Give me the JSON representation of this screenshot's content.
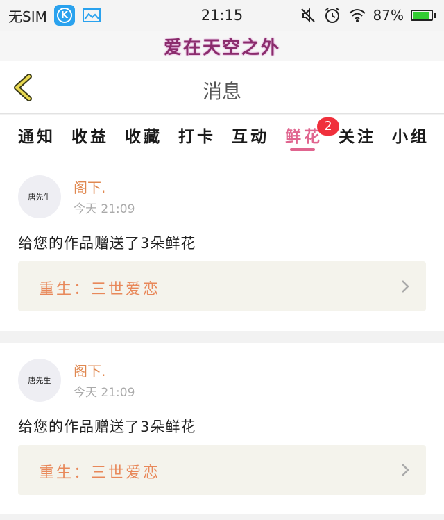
{
  "status_bar": {
    "carrier": "无SIM",
    "time": "21:15",
    "battery": "87%",
    "battery_level": 0.87,
    "icons": [
      "k-app-icon",
      "gallery-icon",
      "mute-icon",
      "alarm-icon",
      "wifi-icon",
      "battery-icon"
    ]
  },
  "banner": {
    "text": "爱在天空之外"
  },
  "header": {
    "title": "消息",
    "back_icon": "back-chevron-icon"
  },
  "tabs": [
    {
      "label": "通知"
    },
    {
      "label": "收益"
    },
    {
      "label": "收藏"
    },
    {
      "label": "打卡"
    },
    {
      "label": "互动"
    },
    {
      "label": "鲜花",
      "active": true,
      "badge": "2"
    },
    {
      "label": "关注"
    },
    {
      "label": "小组"
    }
  ],
  "messages": [
    {
      "avatar_text": "唐先生",
      "sender": "阁下.",
      "time": "今天 21:09",
      "text": "给您的作品赠送了3朵鲜花",
      "work_title": "重生：三世爱恋"
    },
    {
      "avatar_text": "唐先生",
      "sender": "阁下.",
      "time": "今天 21:09",
      "text": "给您的作品赠送了3朵鲜花",
      "work_title": "重生：三世爱恋"
    }
  ],
  "colors": {
    "accent": "#e0658f",
    "sender": "#e08850",
    "badge": "#f0303c",
    "work_bg": "#f4f3ec"
  }
}
